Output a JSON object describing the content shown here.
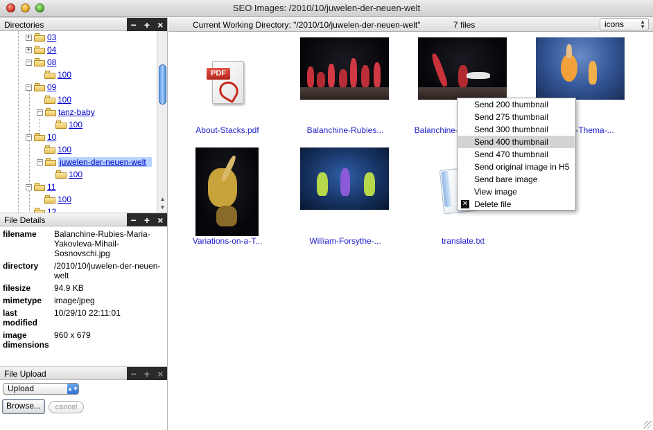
{
  "window": {
    "title": "SEO Images: /2010/10/juwelen-der-neuen-welt"
  },
  "directories": {
    "title": "Directories",
    "controls": [
      "−",
      "+",
      "×"
    ],
    "items": [
      {
        "label": "03",
        "toggle": "+"
      },
      {
        "label": "04",
        "toggle": "+"
      },
      {
        "label": "08",
        "toggle": "−"
      },
      {
        "label": "100",
        "toggle": ""
      },
      {
        "label": "09",
        "toggle": "−"
      },
      {
        "label": "100",
        "toggle": ""
      },
      {
        "label": "tanz-baby",
        "toggle": "−"
      },
      {
        "label": "100",
        "toggle": ""
      },
      {
        "label": "10",
        "toggle": "−"
      },
      {
        "label": "100",
        "toggle": ""
      },
      {
        "label": "juwelen-der-neuen-welt",
        "toggle": "−"
      },
      {
        "label": "100",
        "toggle": ""
      },
      {
        "label": "11",
        "toggle": "−"
      },
      {
        "label": "100",
        "toggle": ""
      },
      {
        "label": "12",
        "toggle": ""
      }
    ]
  },
  "file_details": {
    "title": "File Details",
    "controls": [
      "−",
      "+",
      "×"
    ],
    "rows": [
      {
        "key": "filename",
        "value": "Balanchine-Rubies-Maria-Yakovleva-Mihail-Sosnovschi.jpg"
      },
      {
        "key": "directory",
        "value": "/2010/10/juwelen-der-neuen-welt"
      },
      {
        "key": "filesize",
        "value": "94.9 KB"
      },
      {
        "key": "mimetype",
        "value": "image/jpeg"
      },
      {
        "key": "last modified",
        "value": "10/29/10 22:11:01"
      },
      {
        "key": "image dimensions",
        "value": "960 x 679"
      }
    ]
  },
  "file_upload": {
    "title": "File Upload",
    "controls": [
      "−",
      "+",
      "×"
    ],
    "select_value": "Upload",
    "browse_label": "Browse...",
    "cancel_label": "cancel"
  },
  "main": {
    "cwd_label": "Current Working Directory: \"/2010/10/juwelen-der-neuen-welt\"",
    "file_count": "7 files",
    "view_mode": "icons",
    "files": [
      {
        "name": "About-Stacks.pdf",
        "kind": "pdf"
      },
      {
        "name": "Balanchine-Rubies...",
        "kind": "image"
      },
      {
        "name": "Balanchine-Rubies...",
        "kind": "image"
      },
      {
        "name": "...-Thema-...",
        "kind": "image"
      },
      {
        "name": "Variations-on-a-T...",
        "kind": "image"
      },
      {
        "name": "William-Forsythe-...",
        "kind": "image"
      },
      {
        "name": "translate.txt",
        "kind": "text"
      }
    ]
  },
  "context_menu": {
    "items": [
      {
        "label": "Send 200 thumbnail"
      },
      {
        "label": "Send 275 thumbnail"
      },
      {
        "label": "Send 300 thumbnail"
      },
      {
        "label": "Send 400 thumbnail",
        "highlighted": true
      },
      {
        "label": "Send 470 thumbnail"
      },
      {
        "label": "Send original image in H5"
      },
      {
        "label": "Send bare image"
      },
      {
        "label": "View image"
      },
      {
        "label": "Delete file",
        "icon": "delete-icon"
      }
    ]
  },
  "colors": {
    "link": "#0000cc",
    "caption": "#2222cc",
    "selection": "#b5d5ff",
    "menu_highlight": "#d4d4d4"
  }
}
